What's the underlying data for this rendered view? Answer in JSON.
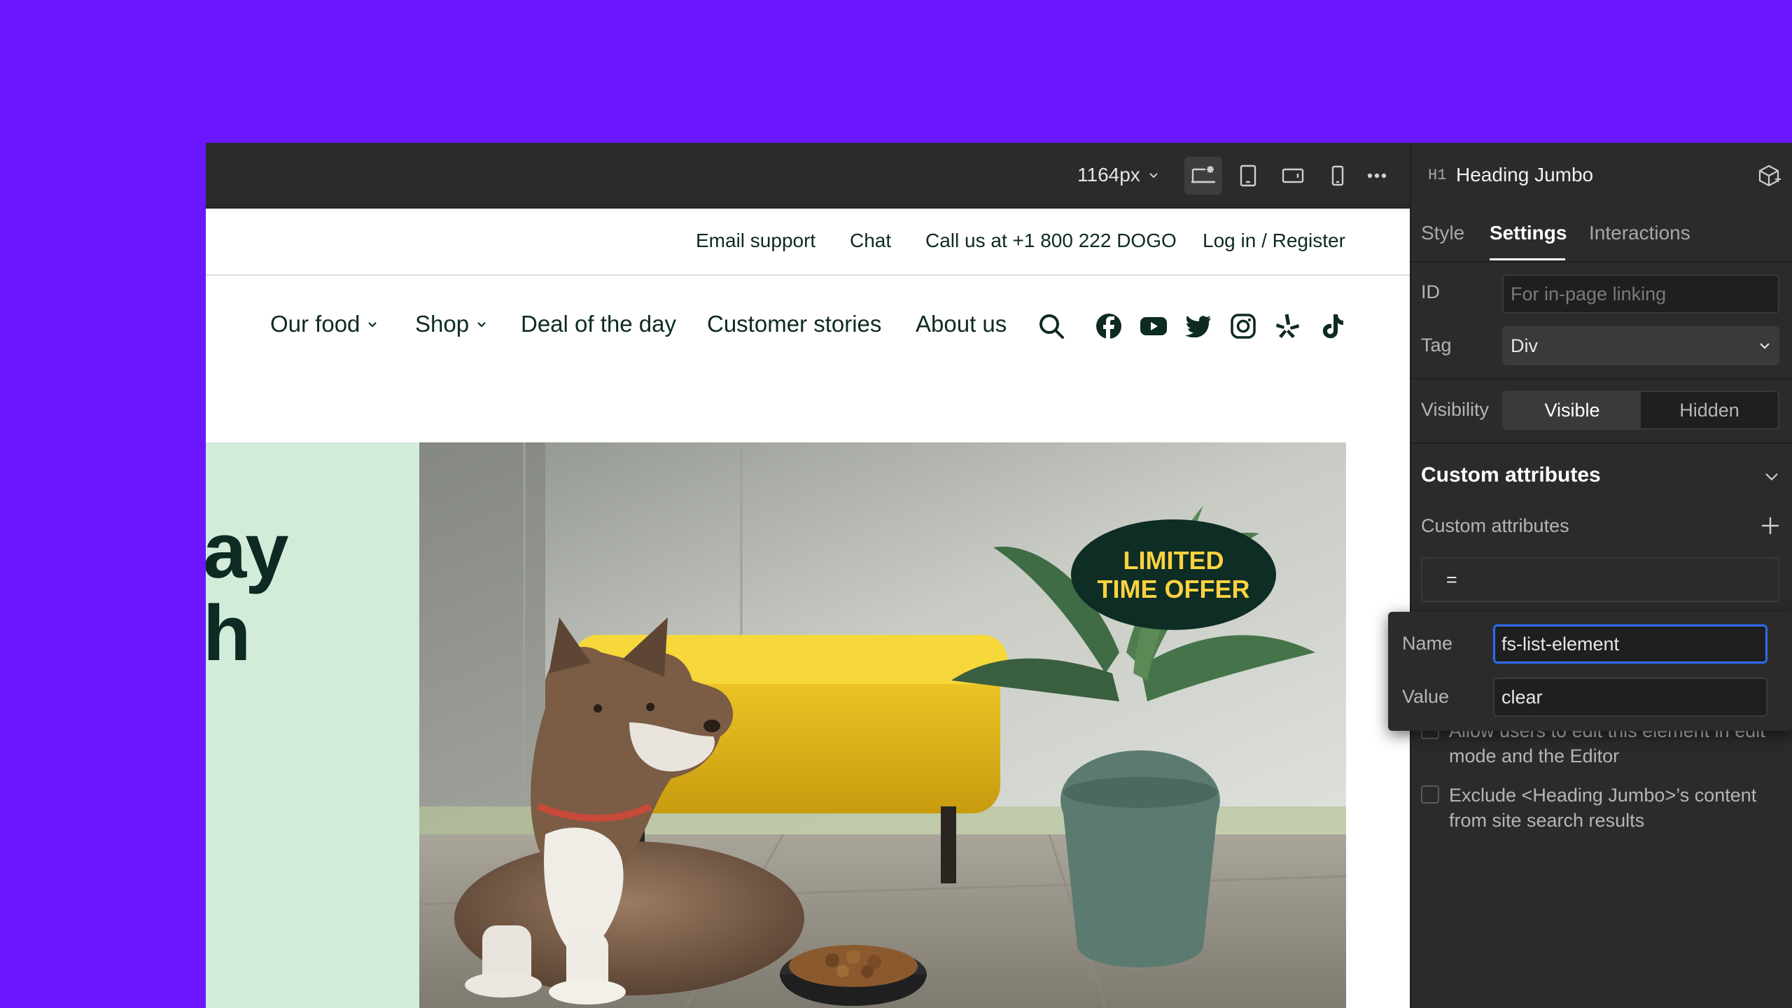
{
  "toolbar": {
    "width_label": "1164px",
    "breakpoint_icons": [
      "desktop-star-icon",
      "tablet-icon",
      "tablet-landscape-icon",
      "mobile-icon",
      "more-icon"
    ]
  },
  "site": {
    "utility_links": [
      "Email support",
      "Chat",
      "Call us at +1 800 222 DOGO",
      "Log in / Register"
    ],
    "nav": {
      "items": [
        {
          "label": "Our food",
          "dropdown": true
        },
        {
          "label": "Shop",
          "dropdown": true
        },
        {
          "label": "Deal of the day",
          "dropdown": false
        },
        {
          "label": "Customer stories",
          "dropdown": false
        },
        {
          "label": "About us",
          "dropdown": false
        }
      ],
      "icons": [
        "search-icon",
        "facebook-icon",
        "youtube-icon",
        "twitter-icon",
        "instagram-icon",
        "yelp-icon",
        "tiktok-icon"
      ]
    },
    "hero": {
      "heading_fragment": "ay\nh",
      "badge": "LIMITED\nTIME OFFER"
    },
    "colors": {
      "brand_dark": "#0d2a23",
      "hero_green": "#d3ecda",
      "badge_yellow": "#ffd23f"
    }
  },
  "panel": {
    "element_tag": "H1",
    "element_name": "Heading Jumbo",
    "tabs": [
      {
        "label": "Style",
        "active": false
      },
      {
        "label": "Settings",
        "active": true
      },
      {
        "label": "Interactions",
        "active": false
      }
    ],
    "id": {
      "label": "ID",
      "placeholder": "For in-page linking"
    },
    "tag": {
      "label": "Tag",
      "value": "Div"
    },
    "visibility": {
      "label": "Visibility",
      "options": [
        "Visible",
        "Hidden"
      ],
      "selected": "Visible"
    },
    "custom_attributes": {
      "section_title": "Custom attributes",
      "list_label": "Custom attributes",
      "entry": "="
    },
    "checkboxes": [
      {
        "label": "Allow users to edit this element in edit mode and the Editor",
        "checked": false
      },
      {
        "label": "Exclude <Heading Jumbo>’s content from site search results",
        "checked": false
      }
    ],
    "popup": {
      "name_label": "Name",
      "name_value": "fs-list-element",
      "value_label": "Value",
      "value_value": "clear"
    }
  }
}
